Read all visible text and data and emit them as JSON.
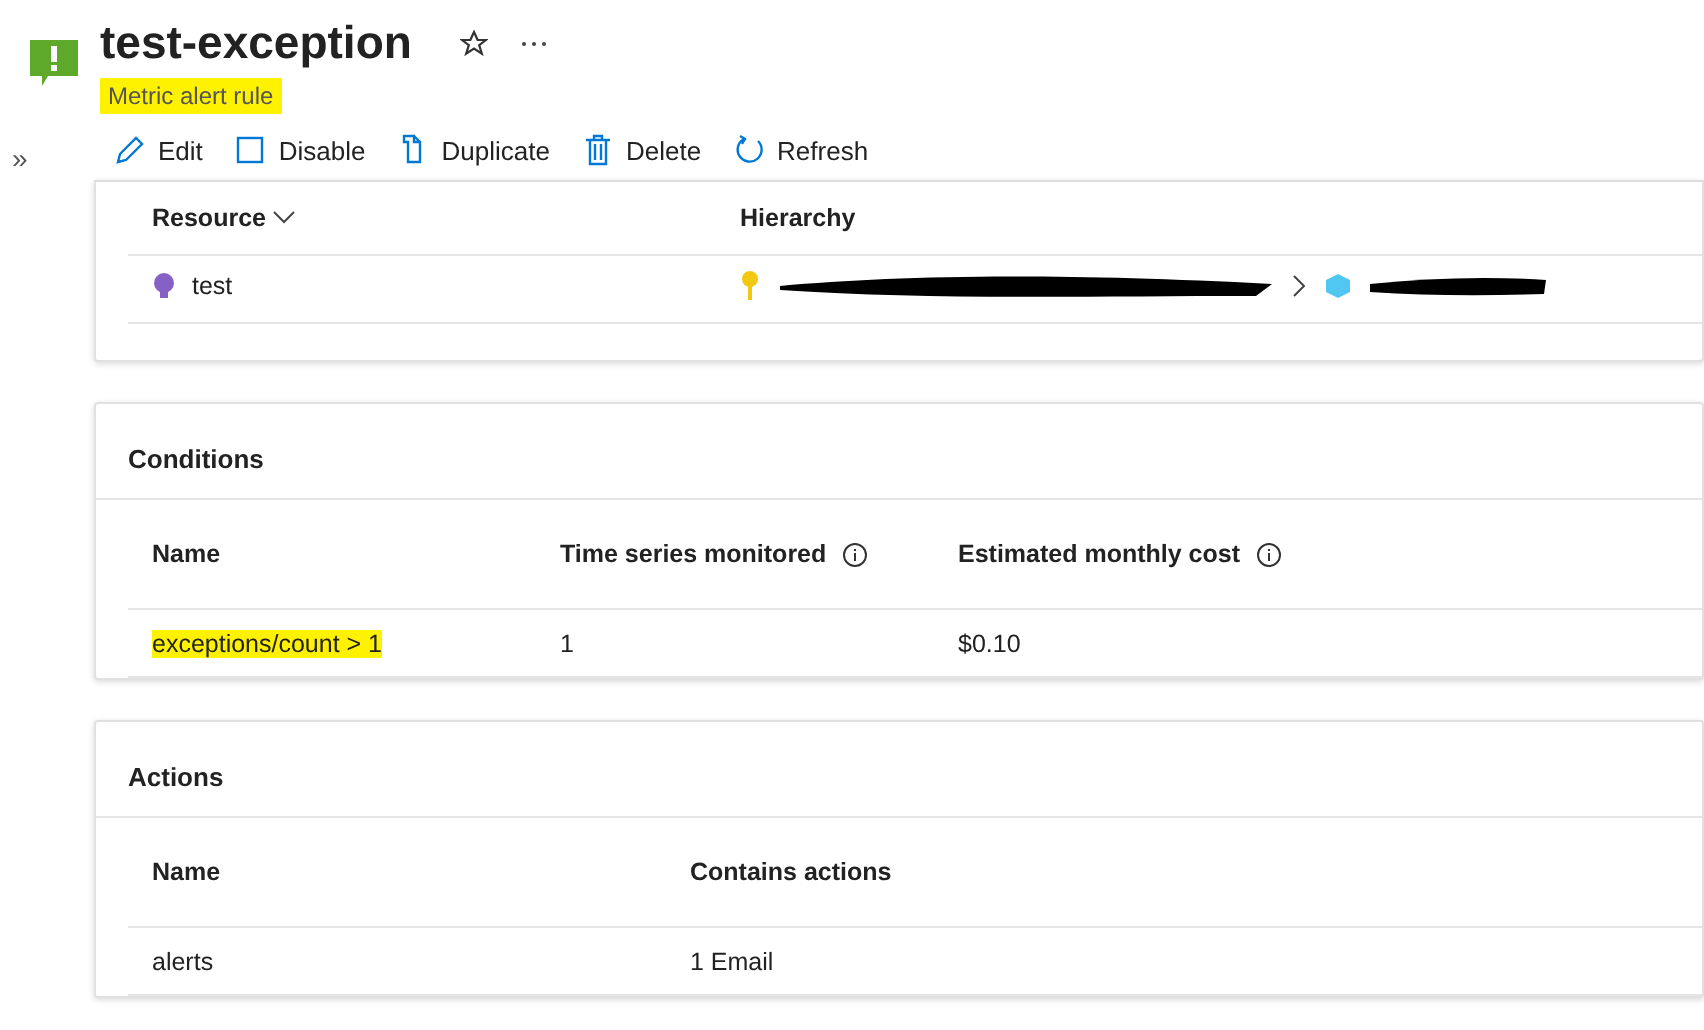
{
  "header": {
    "title": "test-exception",
    "subtitle": "Metric alert rule",
    "subtitle_highlighted": true
  },
  "sidebar_toggle": "»",
  "toolbar": [
    {
      "label": "Edit",
      "kind": "edit"
    },
    {
      "label": "Disable",
      "kind": "disable"
    },
    {
      "label": "Duplicate",
      "kind": "duplicate"
    },
    {
      "label": "Delete",
      "kind": "delete"
    },
    {
      "label": "Refresh",
      "kind": "refresh"
    }
  ],
  "scope": {
    "columns": [
      "Resource",
      "Hierarchy"
    ],
    "rows": [
      {
        "resource": "test"
      }
    ]
  },
  "conditions": {
    "title": "Conditions",
    "columns": [
      "Name",
      "Time series monitored",
      "Estimated monthly cost"
    ],
    "rows": [
      {
        "name": "exceptions/count > 1",
        "highlighted": true,
        "series": "1",
        "cost": "$0.10"
      }
    ]
  },
  "actions": {
    "title": "Actions",
    "columns": [
      "Name",
      "Contains actions"
    ],
    "rows": [
      {
        "name": "alerts",
        "contains": "1 Email"
      }
    ]
  }
}
